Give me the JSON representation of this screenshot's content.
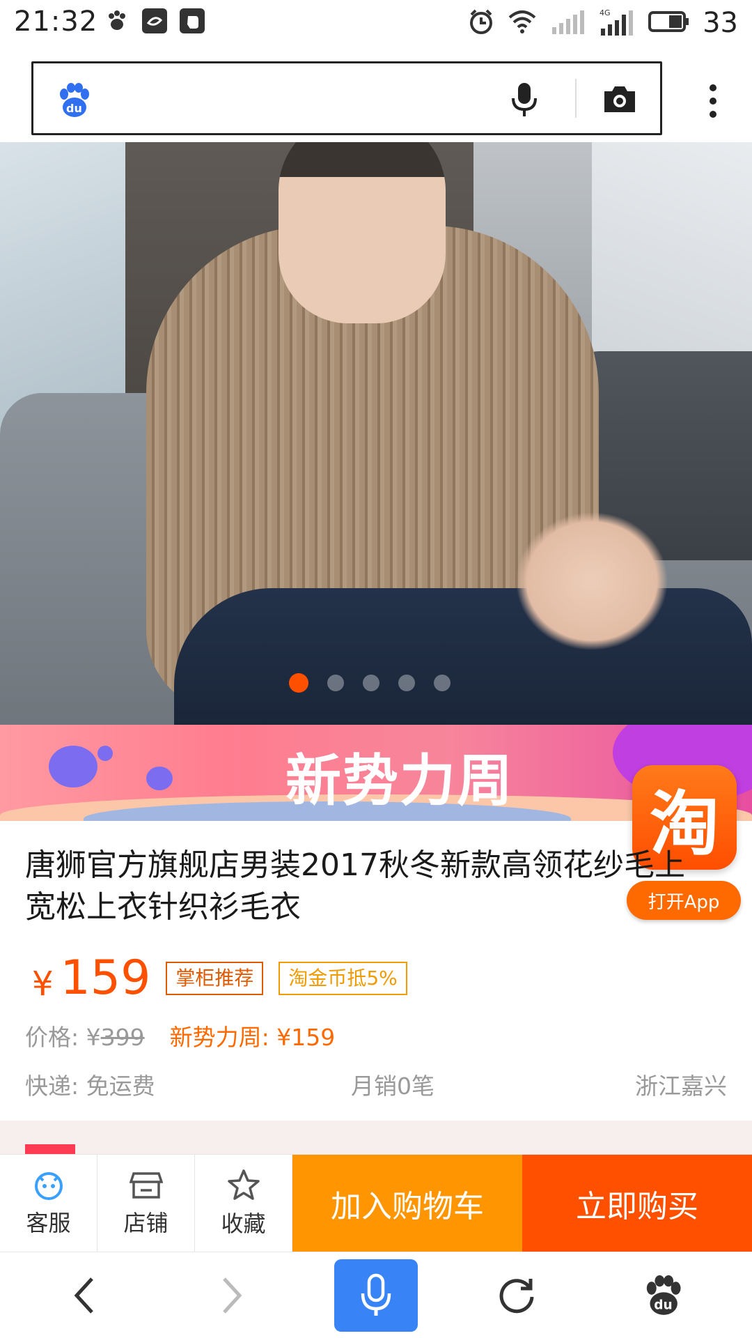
{
  "status_bar": {
    "time": "21:32",
    "battery": "33",
    "network": "4G"
  },
  "search": {
    "placeholder": ""
  },
  "carousel": {
    "total": 5,
    "active": 1
  },
  "promo": {
    "title": "新势力周"
  },
  "floating": {
    "logo_char": "淘",
    "open_app_label": "打开App"
  },
  "product": {
    "title": "唐狮官方旗舰店男装2017秋冬新款高领花纱毛上宽松上衣针织衫毛衣",
    "currency": "¥",
    "price": "159",
    "tags": [
      "掌柜推荐",
      "淘金币抵5%"
    ],
    "original_price_label": "价格: ¥",
    "original_price": "399",
    "event_price": "新势力周: ¥159",
    "shipping": "快递: 免运费",
    "monthly_sales": "月销0笔",
    "location": "浙江嘉兴"
  },
  "actions": {
    "service_label": "客服",
    "shop_label": "店铺",
    "favorite_label": "收藏",
    "add_to_cart": "加入购物车",
    "buy_now": "立即购买"
  },
  "colors": {
    "accent": "#ff5000",
    "cart": "#ff9500",
    "voice": "#3884f6",
    "baidu_blue": "#2f6ff0"
  }
}
